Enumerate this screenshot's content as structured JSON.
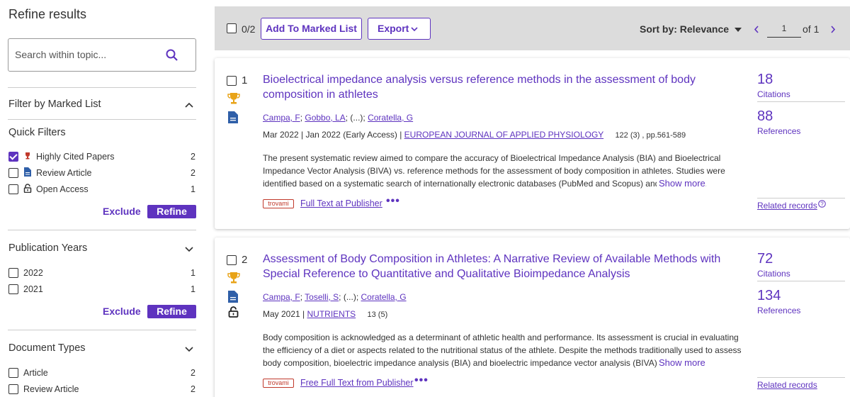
{
  "sidebar": {
    "title": "Refine results",
    "search_placeholder": "Search within topic...",
    "marked_list": "Filter by Marked List",
    "quick_filters": {
      "heading": "Quick Filters",
      "items": [
        {
          "label": "Highly Cited Papers",
          "count": "2",
          "checked": true,
          "icon": "trophy-icon"
        },
        {
          "label": "Review Article",
          "count": "2",
          "checked": false,
          "icon": "document-icon"
        },
        {
          "label": "Open Access",
          "count": "1",
          "checked": false,
          "icon": "lock-icon"
        }
      ]
    },
    "exclude_label": "Exclude",
    "refine_label": "Refine",
    "pub_years": {
      "heading": "Publication Years",
      "items": [
        {
          "label": "2022",
          "count": "1"
        },
        {
          "label": "2021",
          "count": "1"
        }
      ]
    },
    "doc_types": {
      "heading": "Document Types",
      "items": [
        {
          "label": "Article",
          "count": "2"
        },
        {
          "label": "Review Article",
          "count": "2"
        }
      ]
    }
  },
  "toolbar": {
    "selected": "0/2",
    "add_marked": "Add To Marked List",
    "export": "Export",
    "sort": "Sort by: Relevance",
    "page_value": "1",
    "page_of": "of",
    "page_total": "1"
  },
  "records": [
    {
      "num": "1",
      "title": "Bioelectrical impedance analysis versus reference methods in the assessment of body composition in athletes",
      "authors": [
        "Campa, F",
        "Gobbo, LA",
        "(...)",
        "Coratella, G"
      ],
      "date": "Mar 2022 | Jan 2022 (Early Access) | ",
      "journal": "EUROPEAN JOURNAL OF APPLIED PHYSIOLOGY",
      "volume": "122 (3) , pp.561-589",
      "abstract": "The present systematic review aimed to compare the accuracy of Bioelectrical Impedance Analysis (BIA) and Bioelectrical Impedance Vector Analysis (BIVA) vs. reference methods for the assessment of body composition in athletes. Studies were identified based on a systematic search of internationally electronic databases (PubMed and Scopus) and hand sea ...",
      "show_more": "Show more",
      "citations": "18",
      "citations_label": "Citations",
      "references": "88",
      "references_label": "References",
      "related": "Related records",
      "fulltext": "Full Text at Publisher",
      "badge": "trovami"
    },
    {
      "num": "2",
      "title": "Assessment of Body Composition in Athletes: A Narrative Review of Available Methods with Special Reference to Quantitative and Qualitative Bioimpedance Analysis",
      "authors": [
        "Campa, F",
        "Toselli, S",
        "(...)",
        "Coratella, G"
      ],
      "date": "May 2021 | ",
      "journal": "NUTRIENTS",
      "volume": "13 (5)",
      "abstract": "Body composition is acknowledged as a determinant of athletic health and performance. Its assessment is crucial in evaluating the efficiency of a diet or aspects related to the nutritional status of the athlete. Despite the methods traditionally used to assess body composition, bioelectric impedance analysis (BIA) and bioelectric impedance vector analysis (BIVA) have ...",
      "show_more": "Show more",
      "citations": "72",
      "citations_label": "Citations",
      "references": "134",
      "references_label": "References",
      "related": "Related records",
      "fulltext": "Free Full Text from Publisher",
      "badge": "trovami"
    }
  ],
  "colors": {
    "accent": "#5e33bf",
    "toolbar_bg": "#dcdcdc",
    "trophy": "#e8a317",
    "doc_icon": "#2f5fa8"
  }
}
